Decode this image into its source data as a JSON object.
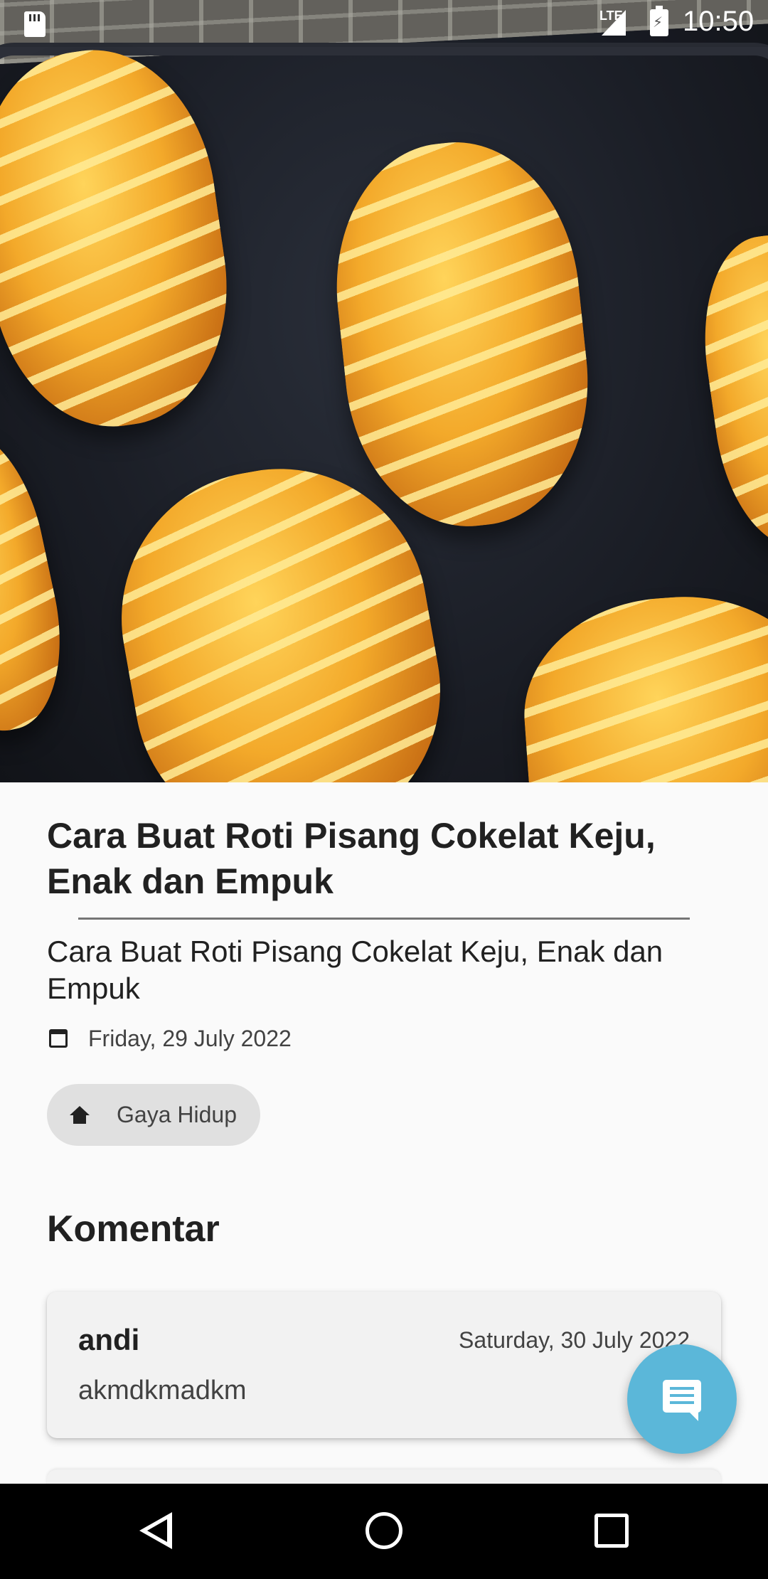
{
  "status_bar": {
    "network": "LTE",
    "time": "10:50",
    "icons": [
      "sd-card-icon",
      "lte-signal-icon",
      "battery-charging-icon"
    ]
  },
  "hero": {
    "image_description_icon": "bread-photo"
  },
  "article": {
    "title": "Cara Buat Roti Pisang Cokelat Keju, Enak dan Empuk",
    "subtitle": "Cara Buat Roti Pisang Cokelat Keju, Enak dan Empuk",
    "date": "Friday, 29 July 2022",
    "category": "Gaya Hidup"
  },
  "comments": {
    "section_title": "Komentar",
    "items": [
      {
        "author": "andi",
        "date": "Saturday, 30 July 2022",
        "text": "akmdkmadkm"
      }
    ]
  },
  "fab": {
    "icon": "comment-icon",
    "color": "#5bb7d9"
  },
  "nav_bar": {
    "icons": [
      "back-icon",
      "home-icon",
      "recents-icon"
    ]
  }
}
